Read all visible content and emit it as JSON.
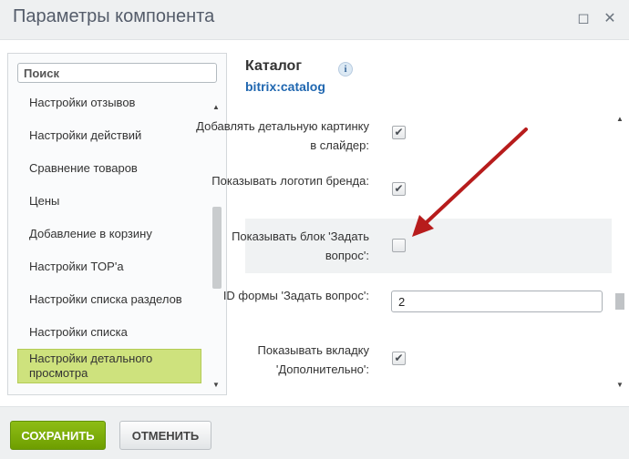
{
  "window": {
    "title": "Параметры компонента",
    "maximize_glyph": "◻",
    "close_glyph": "✕"
  },
  "sidebar": {
    "search_placeholder": "Поиск",
    "items": [
      {
        "label": "Настройки отзывов"
      },
      {
        "label": "Настройки действий"
      },
      {
        "label": "Сравнение товаров"
      },
      {
        "label": "Цены"
      },
      {
        "label": "Добавление в корзину"
      },
      {
        "label": "Настройки TOP'a"
      },
      {
        "label": "Настройки списка разделов"
      },
      {
        "label": "Настройки списка"
      },
      {
        "label": "Настройки детального просмотра",
        "active": true
      }
    ],
    "scroll_up": "▲",
    "scroll_down": "▼"
  },
  "component": {
    "title": "Каталог",
    "code": "bitrix:catalog",
    "info_glyph": "i"
  },
  "params": [
    {
      "label": "Добавлять детальную картинку в слайдер:",
      "type": "checkbox",
      "checked": true
    },
    {
      "label": "Показывать логотип бренда:",
      "type": "checkbox",
      "checked": true
    },
    {
      "label": "Показывать блок 'Задать вопрос':",
      "type": "checkbox",
      "checked": false,
      "highlighted": true
    },
    {
      "label": "ID формы 'Задать вопрос':",
      "type": "text",
      "value": "2"
    },
    {
      "label": "Показывать вкладку 'Дополнительно':",
      "type": "checkbox",
      "checked": true
    }
  ],
  "check_glyph": "✔",
  "annotation": {
    "arrow_color": "#b71c1c"
  },
  "footer": {
    "save_label": "СОХРАНИТЬ",
    "cancel_label": "ОТМЕНИТЬ"
  }
}
